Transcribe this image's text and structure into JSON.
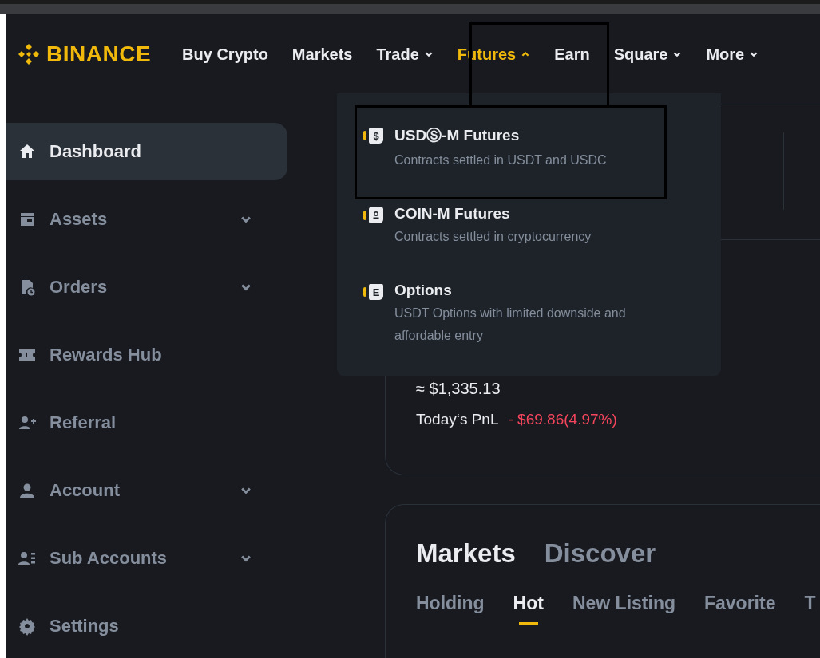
{
  "header": {
    "logo": "BINANCE",
    "nav": [
      {
        "label": "Buy Crypto",
        "selected": false
      },
      {
        "label": "Markets",
        "selected": false
      },
      {
        "label": "Trade",
        "expanded": false,
        "selected": false
      },
      {
        "label": "Futures",
        "expanded": true,
        "selected": true
      },
      {
        "label": "Earn",
        "selected": false
      },
      {
        "label": "Square",
        "expanded": false,
        "selected": false
      },
      {
        "label": "More",
        "expanded": false,
        "selected": false
      }
    ]
  },
  "futures_menu": [
    {
      "title": "USDⓈ-M Futures",
      "description": "Contracts settled in USDT and USDC",
      "icon": {
        "kind": "glyph",
        "glyph": "$"
      }
    },
    {
      "title": "COIN-M Futures",
      "description": "Contracts settled in cryptocurrency",
      "icon": {
        "kind": "coin"
      }
    },
    {
      "title": "Options",
      "description": "USDT Options with limited downside and affordable entry",
      "icon": {
        "kind": "glyph",
        "glyph": "E"
      }
    }
  ],
  "sidebar": [
    {
      "label": "Dashboard",
      "has_submenu": false,
      "selected": true
    },
    {
      "label": "Assets",
      "has_submenu": true,
      "selected": false
    },
    {
      "label": "Orders",
      "has_submenu": true,
      "selected": false
    },
    {
      "label": "Rewards Hub",
      "has_submenu": false,
      "selected": false
    },
    {
      "label": "Referral",
      "has_submenu": false,
      "selected": false
    },
    {
      "label": "Account",
      "has_submenu": true,
      "selected": false
    },
    {
      "label": "Sub Accounts",
      "has_submenu": true,
      "selected": false
    },
    {
      "label": "Settings",
      "has_submenu": false,
      "selected": false
    }
  ],
  "balance": {
    "estimate": "≈ $1,335.13",
    "pnl_label": "Today‘s PnL",
    "pnl_value": "- $69.86(4.97%)"
  },
  "markets": {
    "tabs": [
      {
        "label": "Markets",
        "selected": true
      },
      {
        "label": "Discover",
        "selected": false
      }
    ],
    "subtabs": [
      {
        "label": "Holding",
        "selected": false
      },
      {
        "label": "Hot",
        "selected": true
      },
      {
        "label": "New Listing",
        "selected": false
      },
      {
        "label": "Favorite",
        "selected": false
      },
      {
        "label": "T",
        "selected": false
      }
    ]
  }
}
